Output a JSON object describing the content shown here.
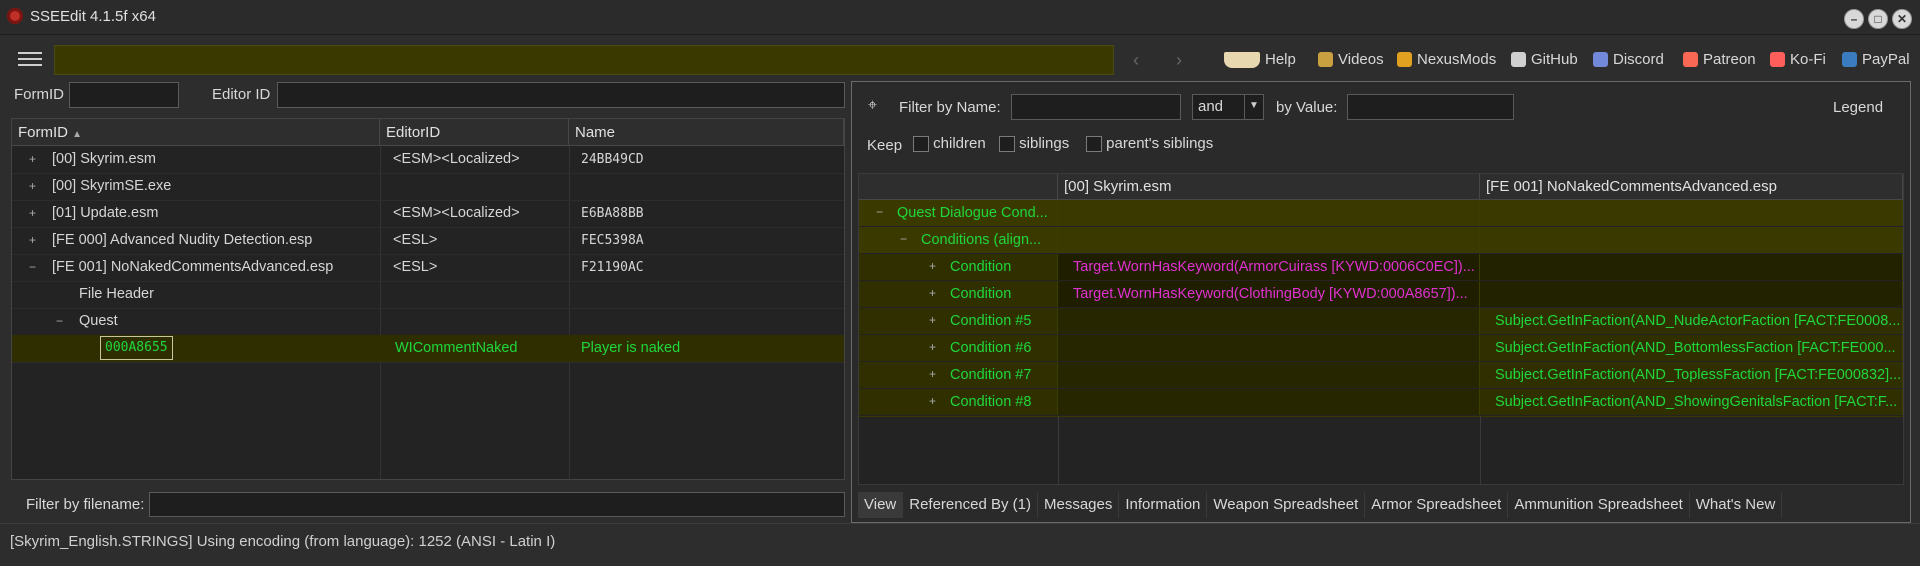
{
  "window": {
    "title": "SSEEdit 4.1.5f x64"
  },
  "toolbar": {
    "links": [
      {
        "label": "Help",
        "icon": "book-icon",
        "color": "#e8d8b0"
      },
      {
        "label": "Videos",
        "icon": "gp-icon",
        "color": "#c8a040"
      },
      {
        "label": "NexusMods",
        "icon": "nexus-icon",
        "color": "#e0a020"
      },
      {
        "label": "GitHub",
        "icon": "github-icon",
        "color": "#cfcfcf"
      },
      {
        "label": "Discord",
        "icon": "discord-icon",
        "color": "#7289da"
      },
      {
        "label": "Patreon",
        "icon": "patreon-icon",
        "color": "#f96854"
      },
      {
        "label": "Ko-Fi",
        "icon": "kofi-icon",
        "color": "#ff5e5b"
      },
      {
        "label": "PayPal",
        "icon": "paypal-icon",
        "color": "#3b7bbf"
      }
    ]
  },
  "filters": {
    "formid_label": "FormID",
    "editorid_label": "Editor ID",
    "filename_label": "Filter by filename:"
  },
  "left_table": {
    "headers": [
      "FormID",
      "EditorID",
      "Name"
    ],
    "rows": [
      {
        "formid": "[00] Skyrim.esm",
        "editorid": "<ESM><Localized>",
        "name": "24BB49CD"
      },
      {
        "formid": "[00] SkyrimSE.exe",
        "editorid": "",
        "name": ""
      },
      {
        "formid": "[01] Update.esm",
        "editorid": "<ESM><Localized>",
        "name": "E6BA88BB"
      },
      {
        "formid": "[FE 000] Advanced Nudity Detection.esp",
        "editorid": "<ESL>",
        "name": "FEC5398A"
      },
      {
        "formid": "[FE 001] NoNakedCommentsAdvanced.esp",
        "editorid": "<ESL>",
        "name": "F21190AC"
      },
      {
        "formid": "File Header",
        "editorid": "",
        "name": ""
      },
      {
        "formid": "Quest",
        "editorid": "",
        "name": ""
      },
      {
        "formid": "000A8655",
        "editorid": "WICommentNaked",
        "name": "Player is naked"
      }
    ]
  },
  "right_panel": {
    "filter_name_label": "Filter by Name:",
    "and_value": "and",
    "by_value_label": "by Value:",
    "legend_label": "Legend",
    "keep_label": "Keep",
    "keep_options": [
      "children",
      "siblings",
      "parent's siblings"
    ],
    "columns": [
      "",
      "[00] Skyrim.esm",
      "[FE 001] NoNakedCommentsAdvanced.esp"
    ],
    "rows": [
      {
        "label": "Quest Dialogue Cond...",
        "col1": "",
        "col2": ""
      },
      {
        "label": "Conditions (align...",
        "col1": "",
        "col2": ""
      },
      {
        "label": "Condition",
        "col1": "Target.WornHasKeyword(ArmorCuirass [KYWD:0006C0EC])...",
        "col2": ""
      },
      {
        "label": "Condition",
        "col1": "Target.WornHasKeyword(ClothingBody [KYWD:000A8657])...",
        "col2": ""
      },
      {
        "label": "Condition #5",
        "col1": "",
        "col2": "Subject.GetInFaction(AND_NudeActorFaction [FACT:FE0008..."
      },
      {
        "label": "Condition #6",
        "col1": "",
        "col2": "Subject.GetInFaction(AND_BottomlessFaction [FACT:FE000..."
      },
      {
        "label": "Condition #7",
        "col1": "",
        "col2": "Subject.GetInFaction(AND_ToplessFaction [FACT:FE000832]..."
      },
      {
        "label": "Condition #8",
        "col1": "",
        "col2": "Subject.GetInFaction(AND_ShowingGenitalsFaction [FACT:F..."
      }
    ],
    "tabs": [
      "View",
      "Referenced By (1)",
      "Messages",
      "Information",
      "Weapon Spreadsheet",
      "Armor Spreadsheet",
      "Ammunition Spreadsheet",
      "What's New"
    ]
  },
  "status_bar": {
    "text": "[Skyrim_English.STRINGS] Using encoding (from language): 1252  (ANSI - Latin I)"
  }
}
